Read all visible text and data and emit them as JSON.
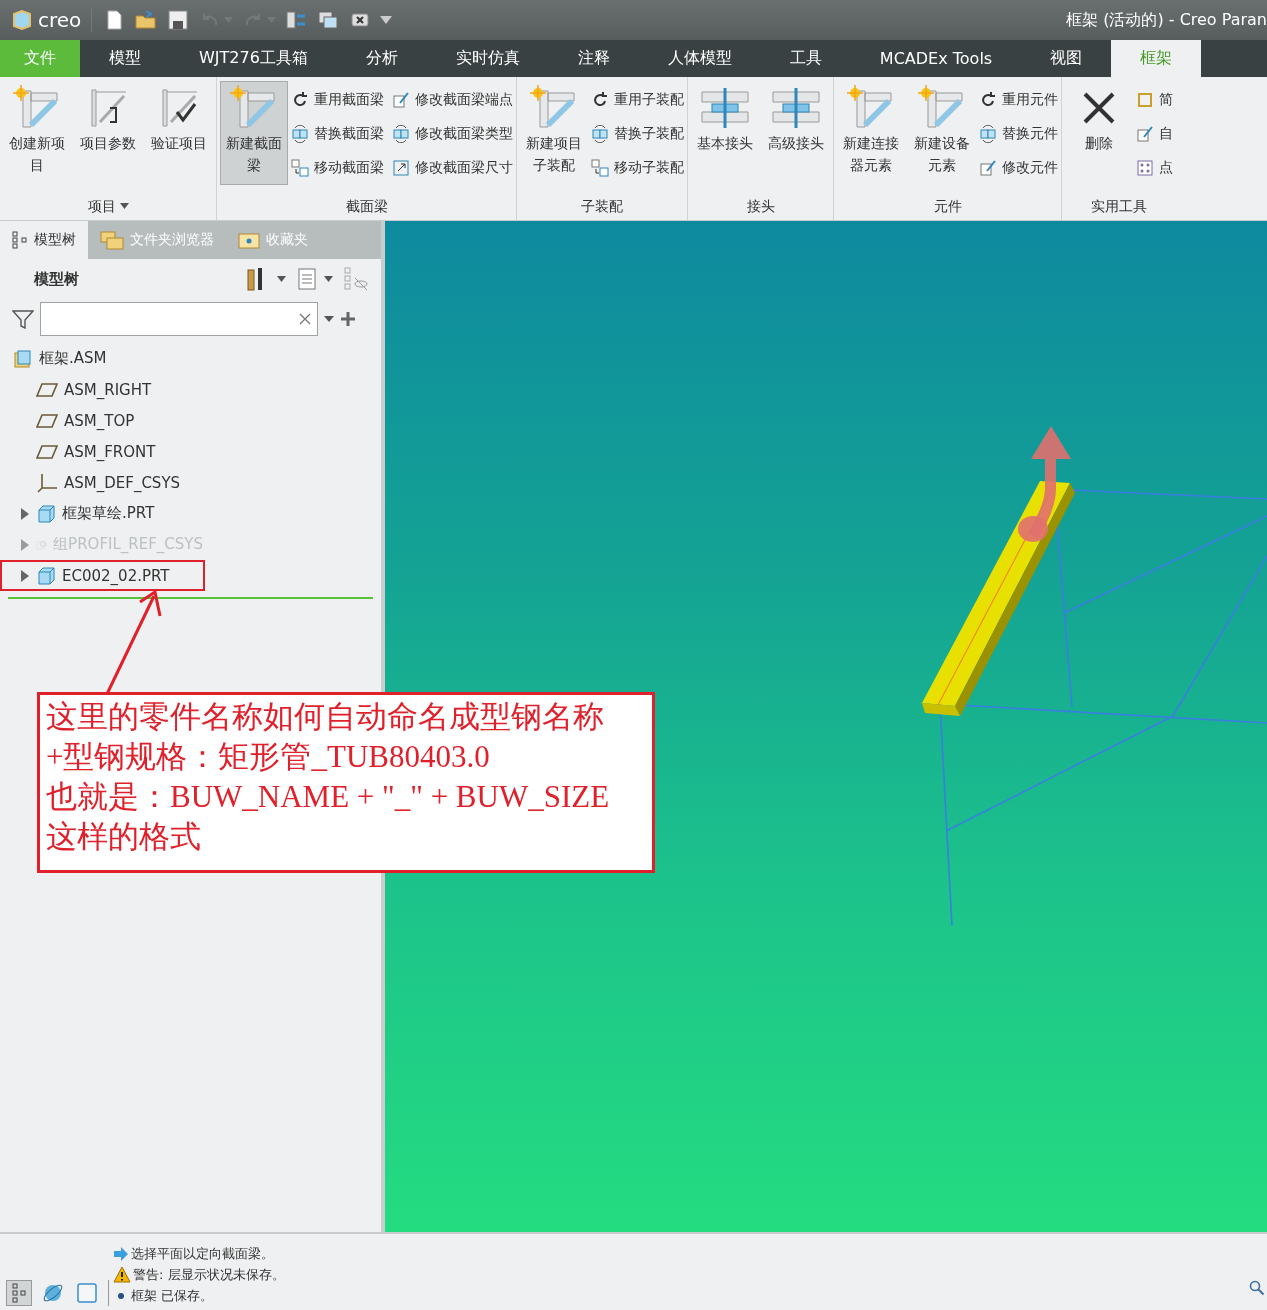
{
  "title_bar": {
    "logo": "creo",
    "title": "框架 (活动的) - Creo Paran"
  },
  "quick_access": [
    {
      "kind": "new",
      "disabled": false,
      "menu": false
    },
    {
      "kind": "open",
      "disabled": false,
      "menu": false
    },
    {
      "kind": "save",
      "disabled": false,
      "menu": false
    },
    {
      "kind": "undo",
      "disabled": true,
      "menu": true
    },
    {
      "kind": "redo",
      "disabled": true,
      "menu": true
    },
    {
      "kind": "regenerate",
      "disabled": false,
      "menu": false
    },
    {
      "kind": "windows",
      "disabled": false,
      "menu": false
    },
    {
      "kind": "close",
      "disabled": false,
      "menu": false
    },
    {
      "kind": "customize",
      "disabled": false,
      "menu": false
    }
  ],
  "tabs": [
    {
      "label": "文件",
      "kind": "file",
      "selected": false
    },
    {
      "label": "模型",
      "kind": "tab",
      "selected": false
    },
    {
      "label": "WJT276工具箱",
      "kind": "tab",
      "selected": false
    },
    {
      "label": "分析",
      "kind": "tab",
      "selected": false
    },
    {
      "label": "实时仿真",
      "kind": "tab",
      "selected": false
    },
    {
      "label": "注释",
      "kind": "tab",
      "selected": false
    },
    {
      "label": "人体模型",
      "kind": "tab",
      "selected": false
    },
    {
      "label": "工具",
      "kind": "tab",
      "selected": false
    },
    {
      "label": "MCADEx Tools",
      "kind": "tab",
      "selected": false
    },
    {
      "label": "视图",
      "kind": "tab",
      "selected": false
    },
    {
      "label": "框架",
      "kind": "tab",
      "selected": true
    }
  ],
  "ribbon": {
    "groups": [
      {
        "label": "项目",
        "menu": true,
        "large": [
          {
            "label": "创建新项目",
            "kind": "new",
            "pressed": false
          },
          {
            "label": "项目参数",
            "kind": "profile",
            "pressed": false
          },
          {
            "label": "验证项目",
            "kind": "verify",
            "pressed": false
          }
        ]
      },
      {
        "label": "截面梁",
        "menu": false,
        "large": [
          {
            "label": "新建截面梁",
            "kind": "new",
            "pressed": true
          }
        ],
        "small": [
          {
            "label": "重用截面梁",
            "kind": "reuse"
          },
          {
            "label": "替换截面梁",
            "kind": "replace"
          },
          {
            "label": "移动截面梁",
            "kind": "move"
          },
          {
            "label": "修改截面梁端点",
            "kind": "edit"
          },
          {
            "label": "修改截面梁类型",
            "kind": "replace"
          },
          {
            "label": "修改截面梁尺寸",
            "kind": "resize"
          }
        ]
      },
      {
        "label": "子装配",
        "menu": false,
        "large": [
          {
            "label": "新建项目子装配",
            "kind": "new",
            "pressed": false
          }
        ],
        "small": [
          {
            "label": "重用子装配",
            "kind": "reuse"
          },
          {
            "label": "替换子装配",
            "kind": "replace"
          },
          {
            "label": "移动子装配",
            "kind": "move"
          }
        ]
      },
      {
        "label": "接头",
        "menu": false,
        "large": [
          {
            "label": "基本接头",
            "kind": "joint",
            "pressed": false
          },
          {
            "label": "高级接头",
            "kind": "joint",
            "pressed": false
          }
        ]
      },
      {
        "label": "元件",
        "menu": false,
        "large": [
          {
            "label": "新建连接器元素",
            "kind": "new",
            "pressed": false
          },
          {
            "label": "新建设备元素",
            "kind": "new",
            "pressed": false
          }
        ],
        "small": [
          {
            "label": "重用元件",
            "kind": "reuse"
          },
          {
            "label": "替换元件",
            "kind": "replace"
          },
          {
            "label": "修改元件",
            "kind": "edit"
          }
        ]
      },
      {
        "label": "实用工具",
        "menu": false,
        "large": [
          {
            "label": "删除",
            "kind": "delete",
            "pressed": false
          }
        ],
        "small": [
          {
            "label": "简",
            "kind": "frame"
          },
          {
            "label": "自",
            "kind": "edit"
          },
          {
            "label": "点",
            "kind": "points"
          }
        ]
      }
    ]
  },
  "panel": {
    "tabs": [
      {
        "label": "模型树",
        "kind": "tree",
        "selected": true
      },
      {
        "label": "文件夹浏览器",
        "kind": "folders",
        "selected": false
      },
      {
        "label": "收藏夹",
        "kind": "favorites",
        "selected": false
      }
    ],
    "header": "模型树",
    "tree": {
      "label": "框架.ASM",
      "kind": "assembly",
      "children": [
        {
          "label": "ASM_RIGHT",
          "kind": "plane",
          "expandable": false,
          "disabled": false,
          "marked": false
        },
        {
          "label": "ASM_TOP",
          "kind": "plane",
          "expandable": false,
          "disabled": false,
          "marked": false
        },
        {
          "label": "ASM_FRONT",
          "kind": "plane",
          "expandable": false,
          "disabled": false,
          "marked": false
        },
        {
          "label": "ASM_DEF_CSYS",
          "kind": "csys",
          "expandable": false,
          "disabled": false,
          "marked": false
        },
        {
          "label": "框架草绘.PRT",
          "kind": "part",
          "expandable": true,
          "disabled": false,
          "marked": false
        },
        {
          "label": "组PROFIL_REF_CSYS",
          "kind": "group",
          "expandable": true,
          "disabled": true,
          "marked": false
        },
        {
          "label": "EC002_02.PRT",
          "kind": "part",
          "expandable": true,
          "disabled": false,
          "marked": true
        }
      ]
    }
  },
  "callout": {
    "lines": [
      "这里的零件名称如何自动命名成型钢名称",
      "+型钢规格：矩形管_TUB80403.0",
      "也就是：BUW_NAME + \"_\" + BUW_SIZE",
      "这样的格式"
    ]
  },
  "status": {
    "buttons": [
      {
        "kind": "tree",
        "pressed": true
      },
      {
        "kind": "globe",
        "pressed": false
      },
      {
        "kind": "window",
        "pressed": false
      }
    ],
    "messages": [
      {
        "kind": "info",
        "text": "选择平面以定向截面梁。"
      },
      {
        "kind": "warning",
        "text": "警告: 层显示状况未保存。"
      },
      {
        "kind": "bullet",
        "text": "框架 已保存。"
      }
    ]
  }
}
